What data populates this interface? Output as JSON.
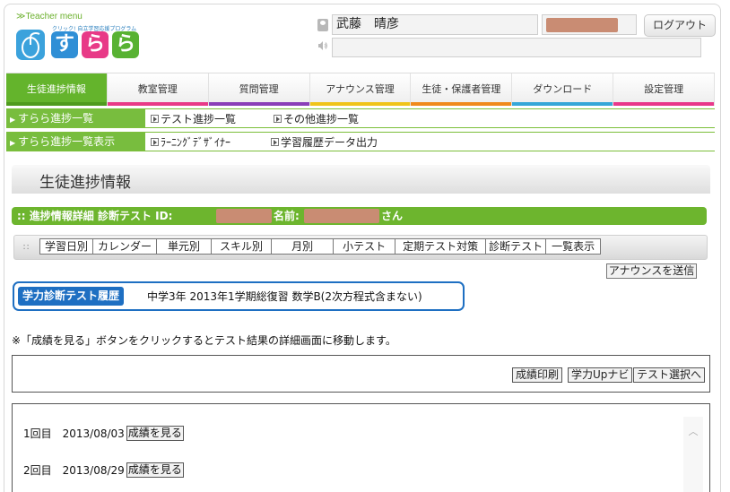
{
  "header": {
    "logo_teacher_label": "≫Teacher menu",
    "logo_tagline": "クリック! 自立学習応援プログラム",
    "logo_tiles": [
      "す",
      "ら",
      "ら"
    ],
    "user_name": "武藤　晴彦",
    "logout_label": "ログアウト",
    "announce_text": ""
  },
  "main_nav": [
    {
      "label": "生徒進捗情報",
      "color": "#4f9b1e",
      "active": true
    },
    {
      "label": "教室管理",
      "color": "#e83a87",
      "active": false
    },
    {
      "label": "質問管理",
      "color": "#8a3fb8",
      "active": false
    },
    {
      "label": "アナウンス管理",
      "color": "#f0c419",
      "active": false
    },
    {
      "label": "生徒・保護者管理",
      "color": "#f08a1c",
      "active": false
    },
    {
      "label": "ダウンロード",
      "color": "#35a7d8",
      "active": false
    },
    {
      "label": "設定管理",
      "color": "#e8388a",
      "active": false
    }
  ],
  "sub_menu_1": {
    "active": "すらら進捗一覧",
    "links": [
      "テスト進捗一覧",
      "その他進捗一覧"
    ]
  },
  "sub_menu_2": {
    "active": "すらら進捗一覧表示",
    "links": [
      "ﾗｰﾆﾝｸﾞﾃﾞｻﾞｲﾅｰ",
      "学習履歴データ出力"
    ]
  },
  "page_title": "生徒進捗情報",
  "detail_bar": {
    "prefix": "進捗情報詳細 診断テスト ID:",
    "name_label": "名前:",
    "suffix": "さん"
  },
  "progress_tabs": [
    "学習日別",
    "カレンダー",
    "単元別",
    "スキル別",
    "月別",
    "小テスト",
    "定期テスト対策",
    "診断テスト",
    "一覧表示"
  ],
  "send_announce_label": "アナウンスを送信",
  "history": {
    "label": "学力診断テスト履歴",
    "value": "中学3年  2013年1学期総復習 数学B(2次方程式含まない)"
  },
  "note": "※「成績を見る」ボタンをクリックするとテスト結果の詳細画面に移動します。",
  "action_buttons": {
    "print": "成績印刷",
    "navi": "学力Upナビ",
    "select": "テスト選択へ"
  },
  "results": [
    {
      "round": "1回目",
      "date": "2013/08/03",
      "button": "成績を見る"
    },
    {
      "round": "2回目",
      "date": "2013/08/29",
      "button": "成績を見る"
    }
  ]
}
